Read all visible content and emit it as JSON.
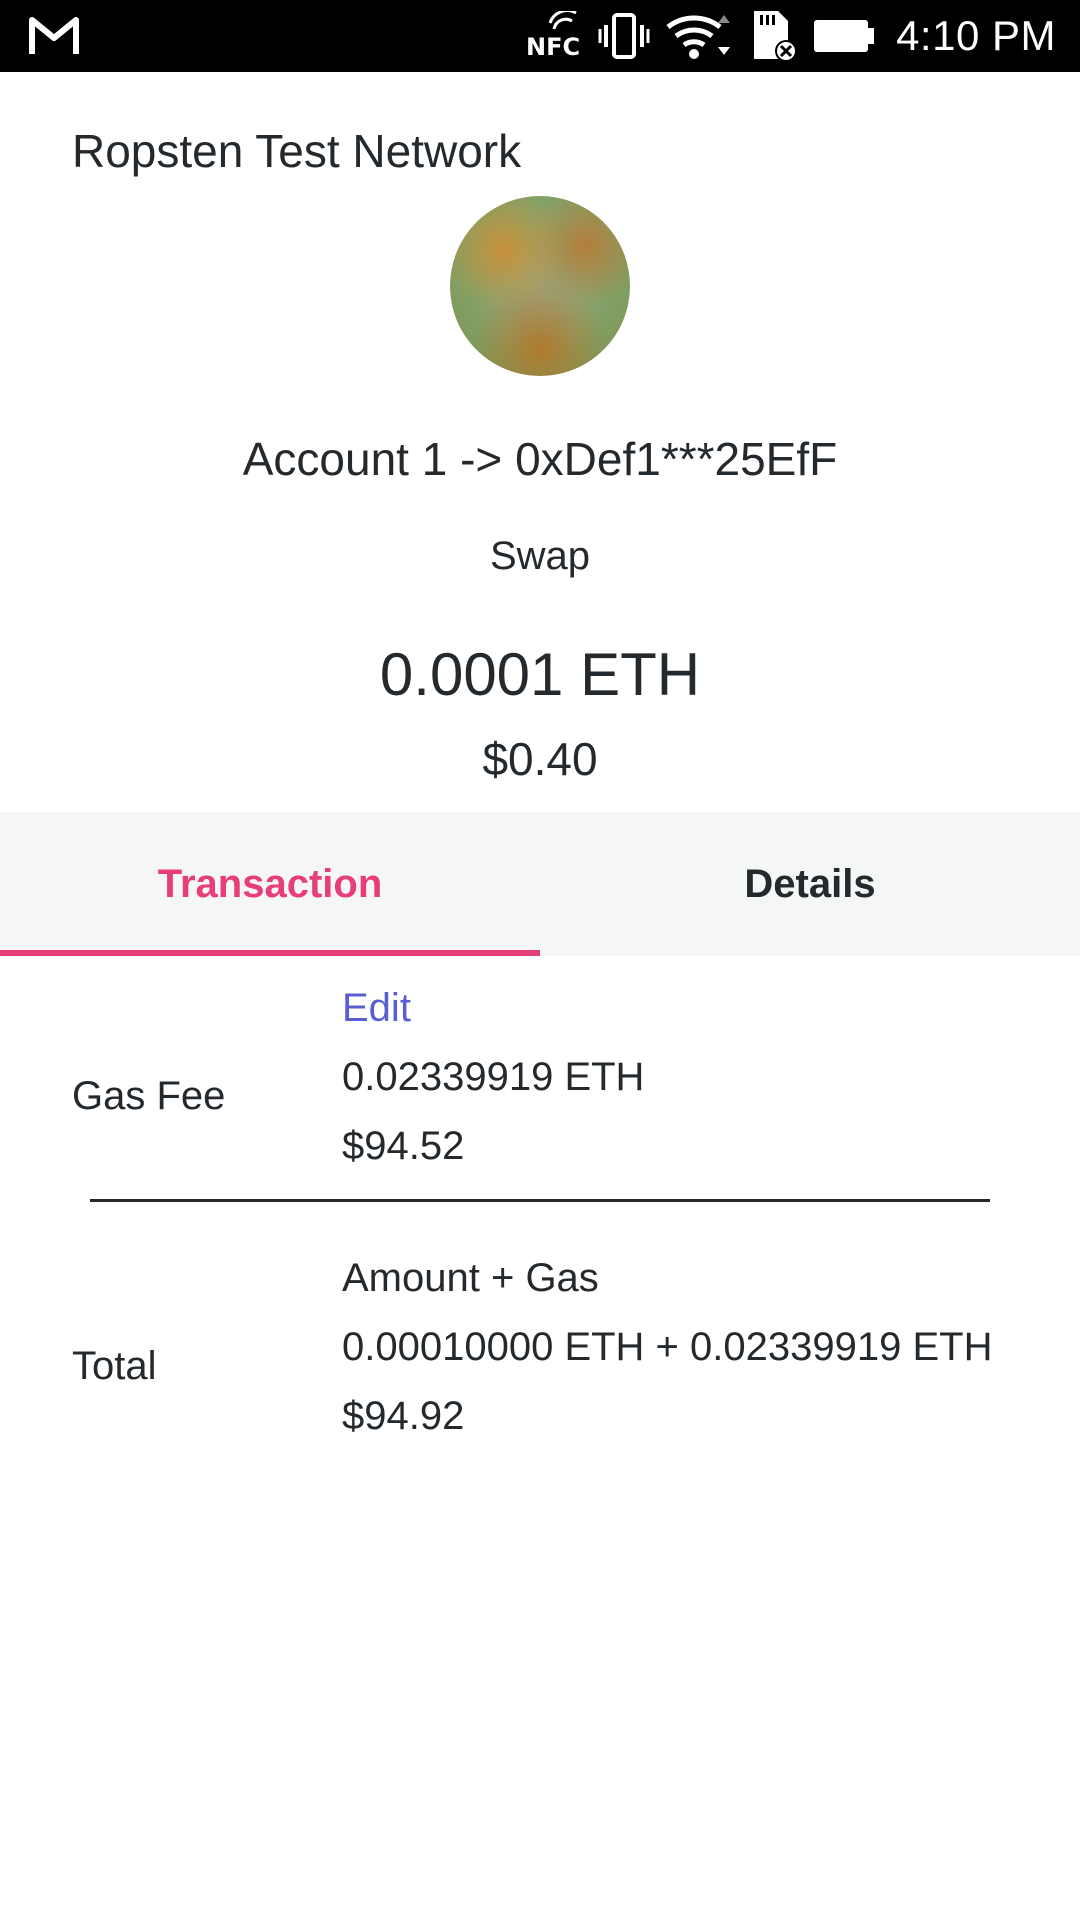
{
  "status_bar": {
    "time": "4:10 PM",
    "icons": [
      "gmail-icon",
      "nfc-icon",
      "vibrate-icon",
      "wifi-icon",
      "sd-card-icon",
      "battery-icon"
    ]
  },
  "network": {
    "name": "Ropsten Test Network"
  },
  "header": {
    "account_line": "Account 1 -> 0xDef1***25EfF",
    "action": "Swap",
    "amount": "0.0001 ETH",
    "fiat": "$0.40"
  },
  "tabs": [
    {
      "label": "Transaction",
      "active": true
    },
    {
      "label": "Details",
      "active": false
    }
  ],
  "gas_fee": {
    "label": "Gas Fee",
    "edit_label": "Edit",
    "eth": "0.02339919 ETH",
    "fiat": "$94.52"
  },
  "total": {
    "label": "Total",
    "caption": "Amount + Gas",
    "eth": "0.00010000 ETH + 0.02339919 ETH",
    "fiat": "$94.92"
  },
  "colors": {
    "accent": "#e73d7b",
    "link": "#5a5fcf",
    "text": "#24292e",
    "tab_bg": "#f5f6f6"
  }
}
